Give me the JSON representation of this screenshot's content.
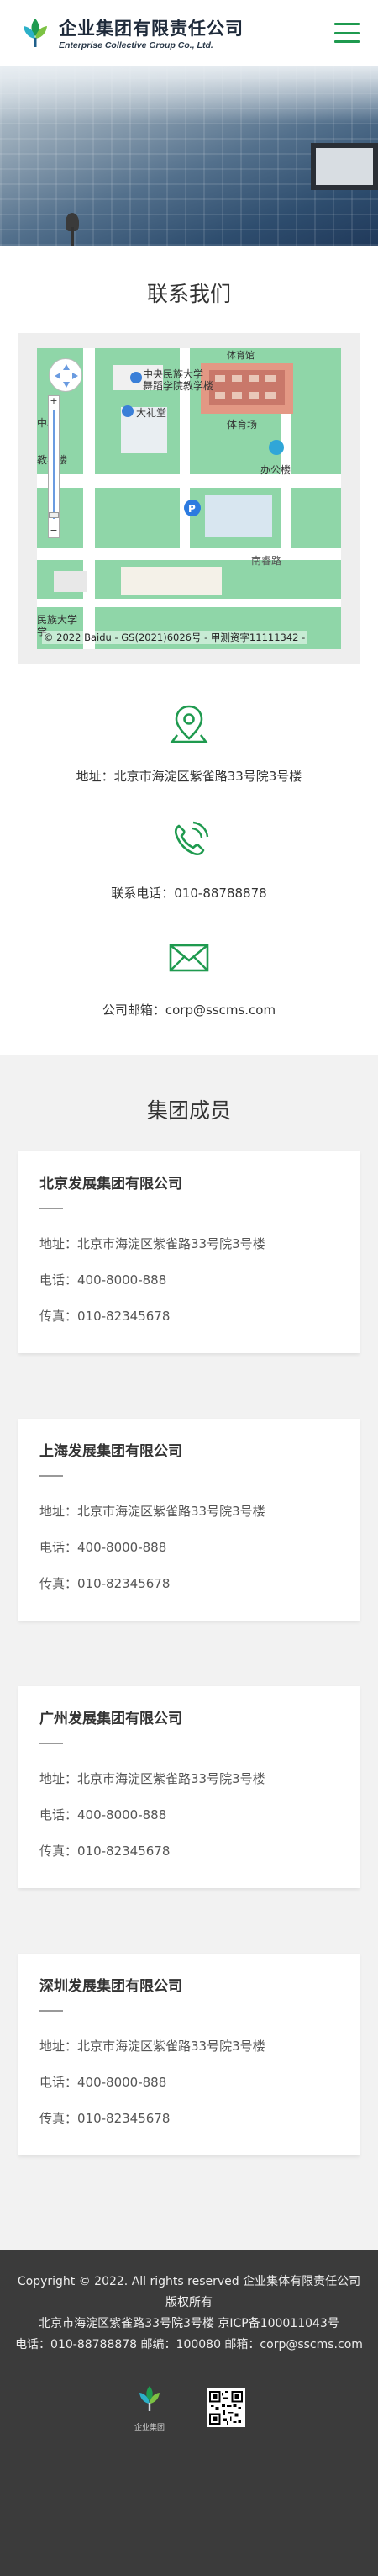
{
  "header": {
    "logo_cn": "企业集团有限责任公司",
    "logo_en": "Enterprise Collective Group Co., Ltd."
  },
  "contact": {
    "title": "联系我们",
    "map": {
      "copyright": "© 2022 Baidu - GS(2021)6026号 - 甲测资字11111342 -",
      "labels": {
        "univ": "中央民族大学",
        "univ2": "舞蹈学院教学楼",
        "hall": "大礼堂",
        "office": "办公楼",
        "road": "南睿路",
        "center": "中心",
        "school": "教学楼",
        "bottom1": "民族大学",
        "bottom2": "学",
        "sports": "体育场",
        "top_right": "体育馆"
      }
    },
    "address": "地址：北京市海淀区紫雀路33号院3号楼",
    "phone": "联系电话：010-88788878",
    "email": "公司邮箱：corp@sscms.com"
  },
  "members": {
    "title": "集团成员",
    "list": [
      {
        "name": "北京发展集团有限公司",
        "address": "地址：北京市海淀区紫雀路33号院3号楼",
        "phone": "电话：400-8000-888",
        "fax": "传真：010-82345678"
      },
      {
        "name": "上海发展集团有限公司",
        "address": "地址：北京市海淀区紫雀路33号院3号楼",
        "phone": "电话：400-8000-888",
        "fax": "传真：010-82345678"
      },
      {
        "name": "广州发展集团有限公司",
        "address": "地址：北京市海淀区紫雀路33号院3号楼",
        "phone": "电话：400-8000-888",
        "fax": "传真：010-82345678"
      },
      {
        "name": "深圳发展集团有限公司",
        "address": "地址：北京市海淀区紫雀路33号院3号楼",
        "phone": "电话：400-8000-888",
        "fax": "传真：010-82345678"
      }
    ]
  },
  "footer": {
    "line1": "Copyright © 2022. All rights reserved 企业集体有限责任公司版权所有",
    "line2": "北京市海淀区紫雀路33号院3号楼   京ICP备100011043号",
    "line3": "电话：010-88788878   邮编：100080   邮箱：corp@sscms.com",
    "logo_text": "企业集团"
  },
  "colors": {
    "brand_green": "#1f9a4f",
    "footer_bg": "#3b3b3b"
  }
}
